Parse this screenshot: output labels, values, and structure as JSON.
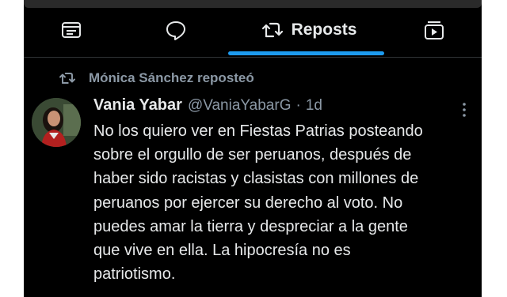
{
  "tabs": [
    {
      "label": "",
      "icon": "list-icon"
    },
    {
      "label": "",
      "icon": "speech-bubble-icon"
    },
    {
      "label": "Reposts",
      "icon": "repost-icon"
    },
    {
      "label": "",
      "icon": "video-icon"
    }
  ],
  "repost_banner": {
    "text": "Mónica Sánchez reposteó",
    "icon": "repost-icon"
  },
  "tweet": {
    "author_name": "Vania Yabar",
    "handle": "@VaniaYabarG",
    "separator": "·",
    "time": "1d",
    "text": "No los quiero ver en Fiestas Patrias posteando\nsobre el orgullo de ser peruanos, después de\nhaber sido racistas y clasistas con millones de\nperuanos por ejercer su derecho al voto. No\npuedes amar la tierra y despreciar a la gente\nque vive en ella. La hipocresía no es\npatriotismo."
  },
  "colors": {
    "background": "#000000",
    "primary_text": "#e7e9ea",
    "secondary_text": "#8b98a5",
    "accent": "#1d9bf0"
  }
}
